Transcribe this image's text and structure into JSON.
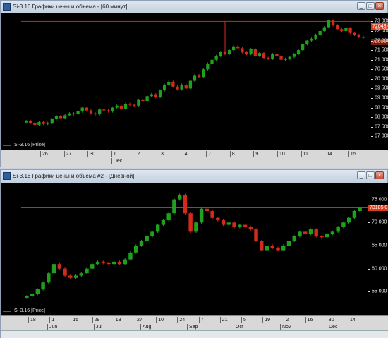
{
  "top_window": {
    "title": "Si-3.16 Графики цены и объема - [60 минут]",
    "price_scale": [
      "73 000",
      "72 500",
      "72 000",
      "71 500",
      "71 000",
      "70 500",
      "70 000",
      "69 500",
      "69 000",
      "68 500",
      "68 000",
      "67 500",
      "67 000"
    ],
    "last_price_label": "72043.0",
    "ref_price_label": "72000.0",
    "legend": "Si-3.16 [Price]",
    "time_ticks": [
      "26",
      "27",
      "30",
      "1",
      "2",
      "3",
      "4",
      "7",
      "8",
      "9",
      "10",
      "11",
      "14",
      "15"
    ],
    "month_labels": [
      "Dec"
    ]
  },
  "bottom_window": {
    "title": "Si-3.16 Графики цены и объема #2 - [Дневной]",
    "price_scale": [
      "75 000",
      "70 000",
      "65 000",
      "60 000",
      "55 000"
    ],
    "last_price_label": "73185.0",
    "legend": "Si-3.16 [Price]",
    "time_ticks": [
      "18",
      "1",
      "15",
      "29",
      "13",
      "27",
      "10",
      "24",
      "7",
      "21",
      "5",
      "19",
      "2",
      "16",
      "30",
      "14"
    ],
    "month_labels": [
      "Jun",
      "Jul",
      "Aug",
      "Sep",
      "Oct",
      "Nov",
      "Dec"
    ]
  },
  "chart_data": [
    {
      "type": "candlestick",
      "title": "Si-3.16 Графики цены и объема - [60 минут]",
      "series_label": "Si-3.16 [Price]",
      "ylim": [
        66900,
        73200
      ],
      "horizontal_line": 73000,
      "closes": [
        67800,
        67700,
        67600,
        67750,
        67650,
        67700,
        67900,
        68050,
        67950,
        68100,
        68200,
        68150,
        68300,
        68500,
        68350,
        68200,
        68150,
        68400,
        68350,
        68300,
        68500,
        68600,
        68450,
        68700,
        68650,
        68600,
        68900,
        68850,
        69100,
        69200,
        69050,
        69400,
        69700,
        69850,
        69600,
        69450,
        69700,
        69500,
        69900,
        70200,
        70100,
        70500,
        70800,
        71000,
        71200,
        71400,
        71300,
        71500,
        71700,
        71600,
        71400,
        71300,
        71550,
        71200,
        71350,
        71100,
        71050,
        71300,
        71200,
        71000,
        71050,
        71150,
        71300,
        71500,
        71800,
        72000,
        72100,
        72300,
        72500,
        72700,
        73050,
        72800,
        72600,
        72500,
        72650,
        72400,
        72300,
        72200,
        72150
      ]
    },
    {
      "type": "candlestick",
      "title": "Si-3.16 Графики цены и объема #2 - [Дневной]",
      "series_label": "Si-3.16 [Price]",
      "ylim": [
        52000,
        78000
      ],
      "horizontal_line": 73185,
      "closes": [
        54000,
        54500,
        55500,
        57000,
        59000,
        61000,
        60000,
        58500,
        58000,
        58500,
        59000,
        60000,
        61000,
        61500,
        61200,
        61000,
        61500,
        61000,
        62000,
        63500,
        65000,
        66000,
        67000,
        68000,
        69500,
        70500,
        72000,
        75000,
        76000,
        72000,
        68000,
        70000,
        73000,
        72500,
        71000,
        70500,
        69500,
        70000,
        69000,
        69500,
        69000,
        68500,
        66000,
        64000,
        65000,
        64500,
        64000,
        65000,
        66000,
        67000,
        68000,
        67500,
        68500,
        67000,
        66800,
        67500,
        68000,
        69000,
        70000,
        71000,
        72500,
        73185
      ]
    }
  ]
}
